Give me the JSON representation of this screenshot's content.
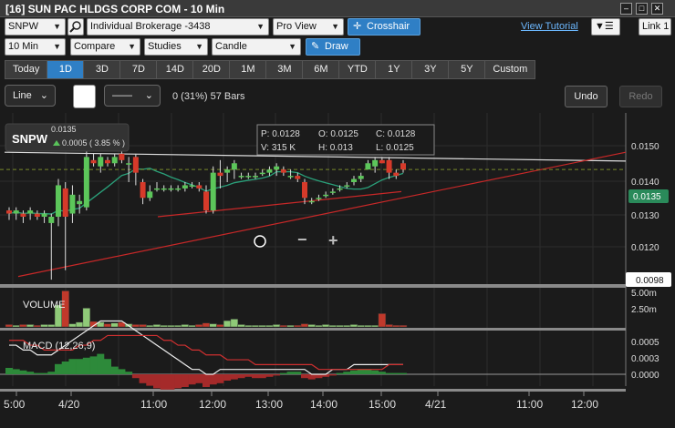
{
  "window": {
    "title": "[16] SUN PAC HLDGS CORP COM - 10 Min",
    "link_label": "Link 1",
    "minimize_label": "–",
    "restore_label": "□",
    "close_label": "✕"
  },
  "toolbar": {
    "symbol": "SNPW",
    "account": "Individual Brokerage -3438",
    "view_mode": "Pro View",
    "crosshair_label": "Crosshair",
    "tutorial_link": "View Tutorial",
    "interval": "10 Min",
    "compare_label": "Compare",
    "studies_label": "Studies",
    "chart_style": "Candle",
    "draw_label": "Draw",
    "icons": [
      "search-icon",
      "crosshair-icon",
      "pencil-icon",
      "menu-icon"
    ]
  },
  "range_tabs": [
    "Today",
    "1D",
    "3D",
    "7D",
    "14D",
    "20D",
    "1M",
    "3M",
    "6M",
    "YTD",
    "1Y",
    "3Y",
    "5Y",
    "Custom"
  ],
  "active_range": "1D",
  "drawing": {
    "tool": "Line",
    "line_style_label": "——",
    "status": "0 (31%) 57 Bars",
    "undo_label": "Undo",
    "redo_label": "Redo",
    "accent_color": "#2f7fc5"
  },
  "quote": {
    "symbol": "SNPW",
    "last": "0.0135",
    "change": "0.0005 ( 3.85 % )",
    "change_color": "#59c35a"
  },
  "ohlc": {
    "p": "P: 0.0128",
    "o": "O: 0.0125",
    "c": "C: 0.0128",
    "v": "V: 315 K",
    "h": "H: 0.013",
    "l": "L: 0.0125"
  },
  "price_axis": {
    "labels": [
      "0.0150",
      "0.0140",
      "0.0130",
      "0.0120"
    ],
    "current": "0.0135",
    "marker": "0.0098"
  },
  "volume_panel": {
    "label": "VOLUME",
    "axis_labels": [
      "5.00m",
      "2.50m"
    ]
  },
  "macd_panel": {
    "label": "MACD (12,26,9)",
    "axis_labels": [
      "0.0005",
      "0.0003",
      "0.0000"
    ]
  },
  "time_axis": [
    "5:00",
    "4/20",
    "11:00",
    "12:00",
    "13:00",
    "14:00",
    "15:00",
    "4/21",
    "11:00",
    "12:00"
  ],
  "zoom": {
    "minus": "−",
    "plus": "+"
  },
  "chart_data": {
    "type": "candlestick",
    "ylim": [
      0.0098,
      0.0153
    ],
    "candles": [
      {
        "o": 0.0122,
        "h": 0.0123,
        "l": 0.0119,
        "c": 0.0121
      },
      {
        "o": 0.0121,
        "h": 0.0123,
        "l": 0.0119,
        "c": 0.0122
      },
      {
        "o": 0.0121,
        "h": 0.0122,
        "l": 0.0118,
        "c": 0.012
      },
      {
        "o": 0.0121,
        "h": 0.0123,
        "l": 0.0119,
        "c": 0.0122
      },
      {
        "o": 0.0121,
        "h": 0.0122,
        "l": 0.0119,
        "c": 0.012
      },
      {
        "o": 0.012,
        "h": 0.0122,
        "l": 0.0118,
        "c": 0.0121
      },
      {
        "o": 0.0118,
        "h": 0.0121,
        "l": 0.01,
        "c": 0.012
      },
      {
        "o": 0.012,
        "h": 0.0132,
        "l": 0.0117,
        "c": 0.013
      },
      {
        "o": 0.0129,
        "h": 0.0131,
        "l": 0.0103,
        "c": 0.012
      },
      {
        "o": 0.0121,
        "h": 0.013,
        "l": 0.0118,
        "c": 0.0127
      },
      {
        "o": 0.0124,
        "h": 0.0127,
        "l": 0.0121,
        "c": 0.0125
      },
      {
        "o": 0.0123,
        "h": 0.0141,
        "l": 0.0122,
        "c": 0.0139
      },
      {
        "o": 0.0138,
        "h": 0.014,
        "l": 0.0136,
        "c": 0.0137
      },
      {
        "o": 0.0136,
        "h": 0.014,
        "l": 0.0134,
        "c": 0.0139
      },
      {
        "o": 0.0138,
        "h": 0.0139,
        "l": 0.0136,
        "c": 0.0137
      },
      {
        "o": 0.0137,
        "h": 0.014,
        "l": 0.0136,
        "c": 0.0139
      },
      {
        "o": 0.014,
        "h": 0.0142,
        "l": 0.0137,
        "c": 0.0138
      },
      {
        "o": 0.0137,
        "h": 0.0139,
        "l": 0.0131,
        "c": 0.0137
      },
      {
        "o": 0.0139,
        "h": 0.014,
        "l": 0.013,
        "c": 0.0134
      },
      {
        "o": 0.0131,
        "h": 0.0132,
        "l": 0.0124,
        "c": 0.0126
      },
      {
        "o": 0.0126,
        "h": 0.013,
        "l": 0.0125,
        "c": 0.0128
      },
      {
        "o": 0.0129,
        "h": 0.0131,
        "l": 0.0128,
        "c": 0.0129
      },
      {
        "o": 0.0129,
        "h": 0.013,
        "l": 0.0128,
        "c": 0.0129
      },
      {
        "o": 0.0129,
        "h": 0.013,
        "l": 0.0128,
        "c": 0.0129
      },
      {
        "o": 0.0129,
        "h": 0.013,
        "l": 0.0128,
        "c": 0.0129
      },
      {
        "o": 0.0129,
        "h": 0.0131,
        "l": 0.0128,
        "c": 0.013
      },
      {
        "o": 0.013,
        "h": 0.0131,
        "l": 0.0129,
        "c": 0.013
      },
      {
        "o": 0.013,
        "h": 0.0131,
        "l": 0.0128,
        "c": 0.0129
      },
      {
        "o": 0.0128,
        "h": 0.013,
        "l": 0.0121,
        "c": 0.0122
      },
      {
        "o": 0.0122,
        "h": 0.0136,
        "l": 0.0121,
        "c": 0.0134
      },
      {
        "o": 0.0134,
        "h": 0.0138,
        "l": 0.0129,
        "c": 0.0133
      },
      {
        "o": 0.0134,
        "h": 0.0136,
        "l": 0.0131,
        "c": 0.0135
      },
      {
        "o": 0.0135,
        "h": 0.0138,
        "l": 0.0132,
        "c": 0.0137
      },
      {
        "o": 0.0133,
        "h": 0.0134,
        "l": 0.0132,
        "c": 0.0133
      },
      {
        "o": 0.0133,
        "h": 0.0134,
        "l": 0.0132,
        "c": 0.0133
      },
      {
        "o": 0.0133,
        "h": 0.0134,
        "l": 0.0132,
        "c": 0.0133
      },
      {
        "o": 0.0134,
        "h": 0.0135,
        "l": 0.0133,
        "c": 0.0134
      },
      {
        "o": 0.0134,
        "h": 0.0136,
        "l": 0.0133,
        "c": 0.0135
      },
      {
        "o": 0.0135,
        "h": 0.0137,
        "l": 0.0133,
        "c": 0.0136
      },
      {
        "o": 0.0135,
        "h": 0.0136,
        "l": 0.0133,
        "c": 0.0134
      },
      {
        "o": 0.0133,
        "h": 0.0135,
        "l": 0.0132,
        "c": 0.0133
      },
      {
        "o": 0.0133,
        "h": 0.0134,
        "l": 0.0131,
        "c": 0.0132
      },
      {
        "o": 0.0131,
        "h": 0.0132,
        "l": 0.0124,
        "c": 0.0126
      },
      {
        "o": 0.0125,
        "h": 0.0126,
        "l": 0.0124,
        "c": 0.0125
      },
      {
        "o": 0.0126,
        "h": 0.0127,
        "l": 0.0125,
        "c": 0.0126
      },
      {
        "o": 0.0127,
        "h": 0.0128,
        "l": 0.0126,
        "c": 0.0127
      },
      {
        "o": 0.0128,
        "h": 0.0129,
        "l": 0.0127,
        "c": 0.0128
      },
      {
        "o": 0.0129,
        "h": 0.013,
        "l": 0.0128,
        "c": 0.0129
      },
      {
        "o": 0.013,
        "h": 0.0131,
        "l": 0.0129,
        "c": 0.013
      },
      {
        "o": 0.0131,
        "h": 0.0133,
        "l": 0.013,
        "c": 0.0132
      },
      {
        "o": 0.0132,
        "h": 0.0134,
        "l": 0.0131,
        "c": 0.0133
      },
      {
        "o": 0.0135,
        "h": 0.0138,
        "l": 0.0135,
        "c": 0.0137
      },
      {
        "o": 0.0136,
        "h": 0.0139,
        "l": 0.0134,
        "c": 0.0138
      },
      {
        "o": 0.0138,
        "h": 0.0139,
        "l": 0.0137,
        "c": 0.0137
      },
      {
        "o": 0.0138,
        "h": 0.0139,
        "l": 0.0132,
        "c": 0.0134
      },
      {
        "o": 0.0134,
        "h": 0.0135,
        "l": 0.0132,
        "c": 0.0133
      },
      {
        "o": 0.0137,
        "h": 0.0138,
        "l": 0.0134,
        "c": 0.0135
      }
    ],
    "volume": [
      0.3,
      0.2,
      0.3,
      0.3,
      0.2,
      0.3,
      0.3,
      2.8,
      4.6,
      0.4,
      0.6,
      2.4,
      0.7,
      0.6,
      0.4,
      0.5,
      0.6,
      0.4,
      0.3,
      0.3,
      0.2,
      0.3,
      0.2,
      0.2,
      0.2,
      0.3,
      0.2,
      0.3,
      0.5,
      0.4,
      0.3,
      0.8,
      1.0,
      0.3,
      0.2,
      0.2,
      0.2,
      0.2,
      0.3,
      0.2,
      0.2,
      0.2,
      0.4,
      0.3,
      0.2,
      0.3,
      0.2,
      0.2,
      0.2,
      0.3,
      0.2,
      0.2,
      0.2,
      1.7,
      0.3,
      0.2,
      0.2
    ],
    "macd_hist": [
      5e-05,
      4e-05,
      3e-05,
      2e-05,
      1e-05,
      1e-05,
      2e-05,
      8e-05,
      0.0001,
      0.00012,
      0.00012,
      0.00013,
      0.00014,
      0.00016,
      0.00012,
      6e-05,
      4e-05,
      2e-05,
      -3e-05,
      -7e-05,
      -9e-05,
      -0.00011,
      -0.00012,
      -0.00012,
      -0.00011,
      -0.0001,
      -8e-05,
      -7e-05,
      -0.0001,
      -8e-05,
      -7e-05,
      -5e-05,
      -4e-05,
      -3e-05,
      -2e-05,
      -3e-05,
      -3e-05,
      -2e-05,
      -1e-05,
      1e-05,
      2e-05,
      2e-05,
      -3e-05,
      -4e-05,
      -3e-05,
      -2e-05,
      -1e-05,
      1e-05,
      2e-05,
      3e-05,
      4e-05,
      4e-05,
      3e-05,
      2e-05,
      1e-05,
      1e-05,
      1e-05
    ],
    "macd_line": [
      0.0006,
      0.0006,
      0.0005,
      0.0005,
      0.0004,
      0.0004,
      0.0004,
      0.0005,
      0.0006,
      0.0007,
      0.0008,
      0.0009,
      0.001,
      0.0011,
      0.0011,
      0.0011,
      0.0011,
      0.001,
      0.0009,
      0.0008,
      0.0007,
      0.0006,
      0.0005,
      0.0004,
      0.0003,
      0.0002,
      0.0001,
      0.0001,
      0.0,
      0.0,
      0.0001,
      0.0001,
      0.0001,
      0.0001,
      0.0001,
      0.0001,
      0.0001,
      0.0001,
      0.0001,
      0.0001,
      0.0001,
      0.0001,
      0.0001,
      0.0,
      0.0,
      0.0,
      0.0001,
      0.0001,
      0.0001,
      0.0002,
      0.0002,
      0.0002,
      0.0002,
      0.0002,
      0.0002,
      0.0002,
      0.0002
    ],
    "signal_line": [
      0.0007,
      0.0007,
      0.0007,
      0.0006,
      0.0006,
      0.0005,
      0.0005,
      0.0005,
      0.0005,
      0.0005,
      0.0006,
      0.0006,
      0.0007,
      0.0007,
      0.0008,
      0.0008,
      0.0008,
      0.0008,
      0.0008,
      0.0008,
      0.0008,
      0.0008,
      0.0007,
      0.0007,
      0.0006,
      0.0006,
      0.0005,
      0.0005,
      0.0004,
      0.0004,
      0.0004,
      0.0003,
      0.0003,
      0.0003,
      0.0003,
      0.0002,
      0.0002,
      0.0002,
      0.0002,
      0.0002,
      0.0002,
      0.0002,
      0.0002,
      0.0002,
      0.0001,
      0.0001,
      0.0001,
      0.0001,
      0.0001,
      0.0001,
      0.0001,
      0.0001,
      0.0001,
      0.0001,
      0.0002,
      0.0002,
      0.0002
    ]
  }
}
